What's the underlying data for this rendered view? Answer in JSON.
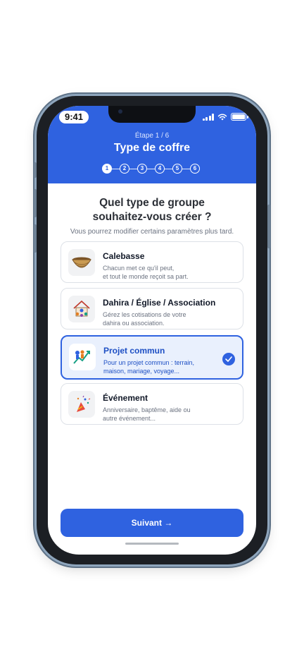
{
  "status_bar": {
    "time": "9:41"
  },
  "header": {
    "step_label": "Étape 1 / 6",
    "title": "Type de coffre",
    "steps": [
      "1",
      "2",
      "3",
      "4",
      "5",
      "6"
    ],
    "current_step": 1
  },
  "question": {
    "line1": "Quel type de groupe",
    "line2": "souhaitez-vous créer ?",
    "subtitle": "Vous pourrez modifier certains paramètres plus tard."
  },
  "options": [
    {
      "title": "Calebasse",
      "desc1": "Chacun met ce qu'il peut,",
      "desc2": "et tout le monde reçoit sa part.",
      "icon": "calabash-bowl-icon",
      "selected": false
    },
    {
      "title": "Dahira / Église / Association",
      "desc1": "Gérez les cotisations de votre",
      "desc2": "dahira ou association.",
      "icon": "community-house-icon",
      "selected": false
    },
    {
      "title": "Projet commun",
      "desc1": "Pour un projet commun : terrain,",
      "desc2": "maison, mariage, voyage...",
      "icon": "shared-project-icon",
      "selected": true
    },
    {
      "title": "Événement",
      "desc1": "Anniversaire, baptême, aide ou",
      "desc2": "autre événement...",
      "icon": "celebration-icon",
      "selected": false
    }
  ],
  "cta": {
    "label": "Suivant →"
  },
  "colors": {
    "primary": "#2f62e0",
    "selected_bg": "#e9f0fd",
    "text_dark": "#2b2f36",
    "text_muted": "#6b7280"
  }
}
